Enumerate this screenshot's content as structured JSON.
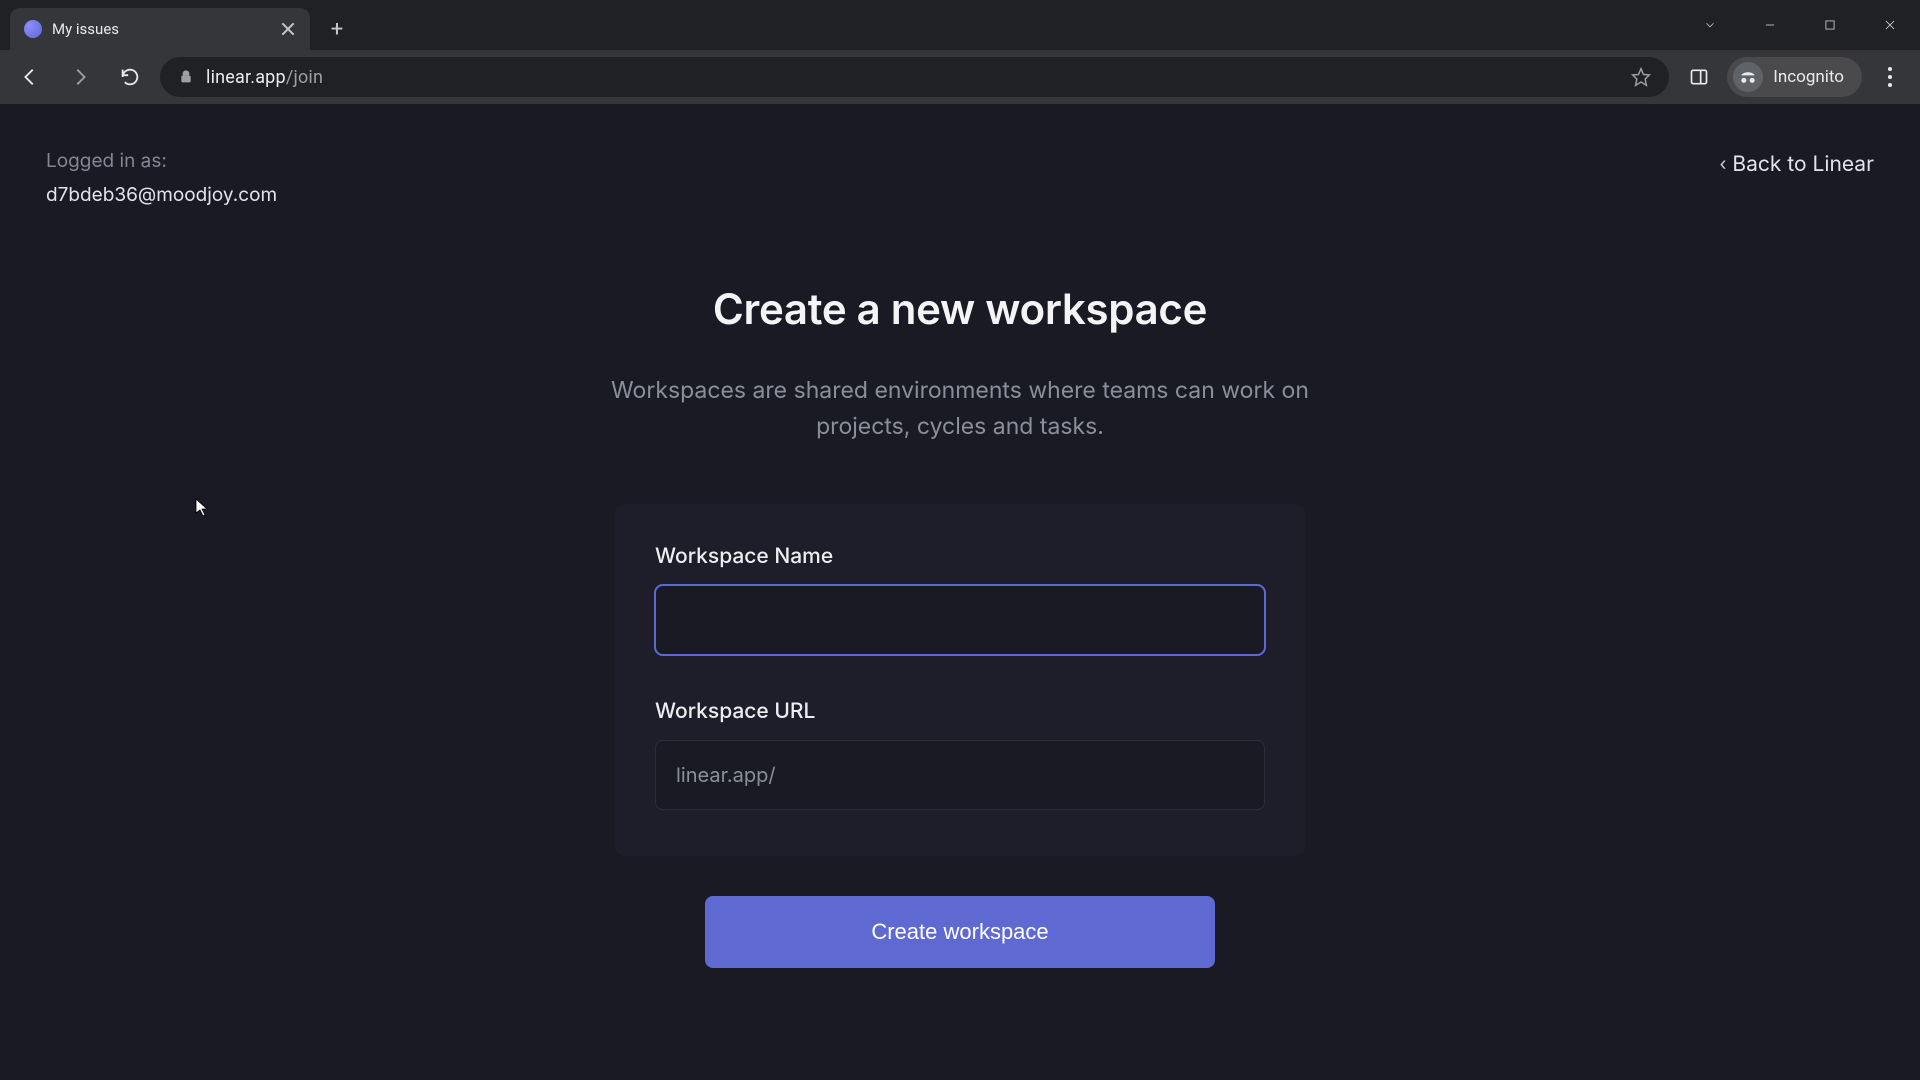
{
  "browser": {
    "tab_title": "My issues",
    "url_host": "linear.app",
    "url_path": "/join",
    "incognito_label": "Incognito"
  },
  "header": {
    "logged_in_label": "Logged in as:",
    "email": "d7bdeb36@moodjoy.com",
    "back_link": "Back to Linear"
  },
  "main": {
    "title": "Create a new workspace",
    "subtitle": "Workspaces are shared environments where teams can work on projects, cycles and tasks."
  },
  "form": {
    "name_label": "Workspace Name",
    "name_value": "",
    "url_label": "Workspace URL",
    "url_prefix": "linear.app/",
    "url_value": "",
    "submit_label": "Create workspace"
  },
  "colors": {
    "accent": "#5e6ad2",
    "page_bg": "#191a23",
    "card_bg": "#1d1e29"
  }
}
